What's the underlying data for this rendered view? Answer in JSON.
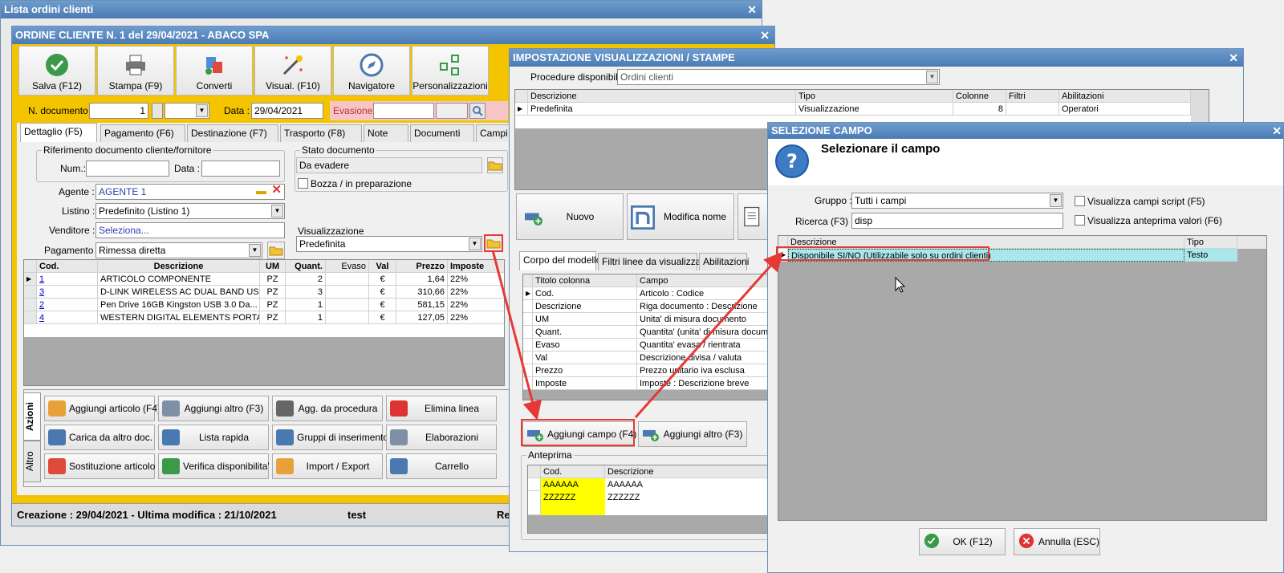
{
  "list_window": {
    "title": "Lista ordini clienti"
  },
  "order": {
    "title": "ORDINE CLIENTE N. 1 del 29/04/2021 - ABACO SPA",
    "toolbar": [
      "Salva (F12)",
      "Stampa (F9)",
      "Converti",
      "Visual. (F10)",
      "Navigatore",
      "Personalizzazioni"
    ],
    "ndoc_label": "N. documento :",
    "ndoc_value": "1",
    "date_label": "Data :",
    "date_value": "29/04/2021",
    "evasione_label": "Evasione:",
    "tabs": [
      "Dettaglio (F5)",
      "Pagamento (F6)",
      "Destinazione (F7)",
      "Trasporto (F8)",
      "Note",
      "Documenti",
      "Campi a"
    ],
    "rif_group": "Riferimento documento cliente/fornitore",
    "num_label": "Num.:",
    "data_label": "Data :",
    "stato_group": "Stato documento",
    "stato_value": "Da evadere",
    "bozza_label": "Bozza / in preparazione",
    "agente_label": "Agente :",
    "agente_value": "AGENTE 1",
    "listino_label": "Listino :",
    "listino_value": "Predefinito (Listino 1)",
    "venditore_label": "Venditore :",
    "venditore_value": "Seleziona...",
    "pagamento_label": "Pagamento :",
    "pagamento_value": "Rimessa diretta",
    "visual_group": "Visualizzazione",
    "visual_value": "Predefinita",
    "grid_headers": [
      "Cod.",
      "Descrizione",
      "UM",
      "Quant.",
      "Evaso",
      "Val",
      "Prezzo",
      "Imposte"
    ],
    "rows": [
      [
        "1",
        "ARTICOLO COMPONENTE",
        "PZ",
        "2",
        "",
        "€",
        "1,64",
        "22%"
      ],
      [
        "3",
        "D-LINK WIRELESS AC DUAL BAND US...",
        "PZ",
        "3",
        "",
        "€",
        "310,66",
        "22%"
      ],
      [
        "2",
        "Pen Drive 16GB  Kingston  USB 3.0 Da...",
        "PZ",
        "1",
        "",
        "€",
        "581,15",
        "22%"
      ],
      [
        "4",
        "WESTERN DIGITAL ELEMENTS PORTA...",
        "PZ",
        "1",
        "",
        "€",
        "127,05",
        "22%"
      ]
    ],
    "side_tabs": [
      "Azioni",
      "Altro"
    ],
    "actions": [
      "Aggiungi articolo (F4)",
      "Aggiungi altro (F3)",
      "Agg. da procedura",
      "Elimina linea",
      "Carica da altro doc.",
      "Lista rapida",
      "Gruppi di inserimento",
      "Elaborazioni",
      "Sostituzione articolo",
      "Verifica disponibilita'",
      "Import / Export",
      "Carrello"
    ],
    "status": [
      "Creazione : 29/04/2021 - Ultima modifica : 21/10/2021",
      "test",
      "Re"
    ]
  },
  "impost": {
    "title": "IMPOSTAZIONE VISUALIZZAZIONI / STAMPE",
    "proc_label": "Procedure disponibili :",
    "proc_value": "Ordini clienti",
    "headers": [
      "Descrizione",
      "Tipo",
      "Colonne",
      "Filtri",
      "Abilitazioni"
    ],
    "row": [
      "Predefinita",
      "Visualizzazione",
      "8",
      "",
      "Operatori"
    ],
    "nuovo": "Nuovo",
    "modifica": "Modifica nome",
    "tabs": [
      "Corpo del modello",
      "Filtri linee da visualizzare",
      "Abilitazioni"
    ],
    "col_headers": [
      "Titolo colonna",
      "Campo"
    ],
    "cols": [
      [
        "Cod.",
        "Articolo : Codice"
      ],
      [
        "Descrizione",
        "Riga documento : Descrizione"
      ],
      [
        "UM",
        "Unita' di misura documento"
      ],
      [
        "Quant.",
        "Quantita' (unita' di misura documento)"
      ],
      [
        "Evaso",
        "Quantita' evasa / rientrata"
      ],
      [
        "Val",
        "Descrizione divisa / valuta"
      ],
      [
        "Prezzo",
        "Prezzo unitario iva esclusa"
      ],
      [
        "Imposte",
        "Imposte : Descrizione breve"
      ]
    ],
    "add_campo": "Aggiungi campo (F4)",
    "add_altro": "Aggiungi altro (F3)",
    "anteprima": "Anteprima",
    "prev_headers": [
      "Cod.",
      "Descrizione"
    ],
    "prev_rows": [
      [
        "AAAAAA",
        "AAAAAA"
      ],
      [
        "ZZZZZZ",
        "ZZZZZZ"
      ]
    ]
  },
  "sel": {
    "title": "SELEZIONE CAMPO",
    "heading": "Selezionare il campo",
    "gruppo_label": "Gruppo :",
    "gruppo_value": "Tutti i campi",
    "ricerca_label": "Ricerca (F3) :",
    "ricerca_value": "disp",
    "chk1": "Visualizza campi script (F5)",
    "chk2": "Visualizza anteprima valori (F6)",
    "headers": [
      "Descrizione",
      "Tipo"
    ],
    "row": [
      "Disponibile SI/NO (Utilizzabile solo su ordini clienti)",
      "Testo"
    ],
    "ok": "OK (F12)",
    "annulla": "Annulla (ESC)"
  },
  "colors": {
    "accent_yellow": "#f5c400",
    "highlight_red": "#e53935",
    "title_blue": "#5a89c0",
    "selected_row": "#a8e8ec"
  }
}
